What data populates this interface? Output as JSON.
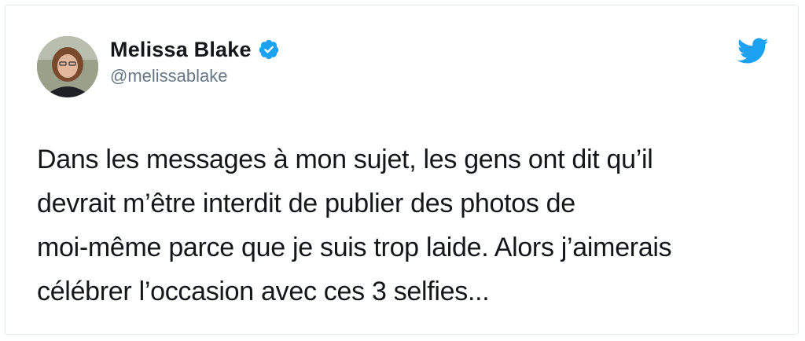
{
  "author": {
    "name": "Melissa Blake",
    "handle": "@melissablake",
    "verified": true
  },
  "icons": {
    "verified": "verified-badge-icon",
    "brand": "twitter-bird-icon"
  },
  "colors": {
    "brand_blue": "#1DA1F2",
    "text": "#14171A",
    "handle_gray": "#657786"
  },
  "tweet": {
    "lines": [
      "Dans les messages à mon sujet, les gens ont dit qu’il",
      "devrait m’être interdit de publier des photos de",
      "moi-même parce que je suis trop laide. Alors j’aimerais",
      "célébrer l’occasion avec ces 3 selfies..."
    ]
  }
}
